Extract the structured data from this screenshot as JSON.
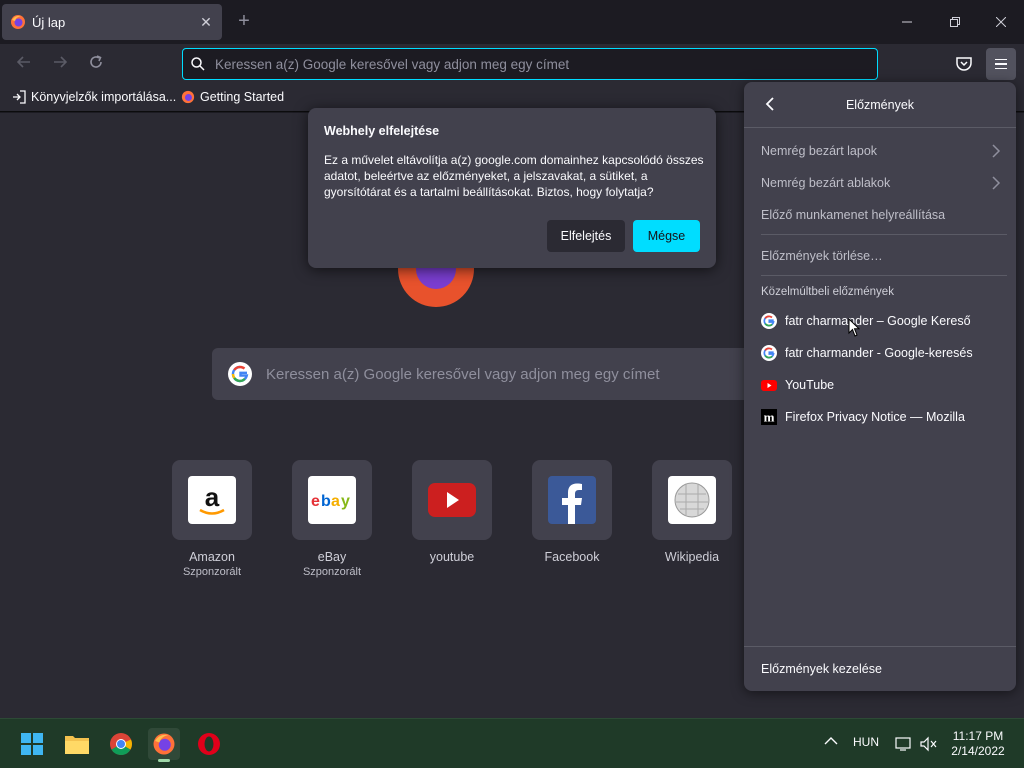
{
  "tabs": [
    {
      "title": "Új lap"
    }
  ],
  "toolbar": {
    "url_placeholder": "Keressen a(z) Google keresővel vagy adjon meg egy címet"
  },
  "bookmarks": [
    {
      "label": "Könyvjelzők importálása..."
    },
    {
      "label": "Getting Started"
    }
  ],
  "newtab": {
    "search_placeholder": "Keressen a(z) Google keresővel vagy adjon meg egy címet",
    "logo_text": "Firefox",
    "tiles": [
      {
        "label": "Amazon",
        "sponsored": "Szponzorált"
      },
      {
        "label": "eBay",
        "sponsored": "Szponzorált"
      },
      {
        "label": "youtube",
        "sponsored": ""
      },
      {
        "label": "Facebook",
        "sponsored": ""
      },
      {
        "label": "Wikipedia",
        "sponsored": ""
      }
    ]
  },
  "dialog": {
    "title": "Webhely elfelejtése",
    "body": "Ez a művelet eltávolítja a(z) google.com domainhez kapcsolódó összes adatot, beleértve az előzményeket, a jelszavakat, a sütiket, a gyorsítótárat és a tartalmi beállításokat. Biztos, hogy folytatja?",
    "forget_label": "Elfelejtés",
    "cancel_label": "Mégse"
  },
  "history_panel": {
    "title": "Előzmények",
    "recently_closed_tabs": "Nemrég bezárt lapok",
    "recently_closed_windows": "Nemrég bezárt ablakok",
    "restore_session": "Előző munkamenet helyreállítása",
    "clear_history": "Előzmények törlése…",
    "recent_section": "Közelmúltbeli előzmények",
    "items": [
      {
        "title": "fatr charmander – Google Kereső",
        "icon": "google-icon"
      },
      {
        "title": "fatr charmander - Google-keresés",
        "icon": "google-icon"
      },
      {
        "title": "YouTube",
        "icon": "youtube-icon"
      },
      {
        "title": "Firefox Privacy Notice — Mozilla",
        "icon": "mozilla-icon"
      }
    ],
    "manage_history": "Előzmények kezelése"
  },
  "taskbar": {
    "language": "HUN",
    "time": "11:17 PM",
    "date": "2/14/2022"
  },
  "colors": {
    "accent": "#00ddff",
    "panel_bg": "#42414d",
    "content_bg": "#2b2a33",
    "taskbar_bg": "#1f3a28"
  }
}
